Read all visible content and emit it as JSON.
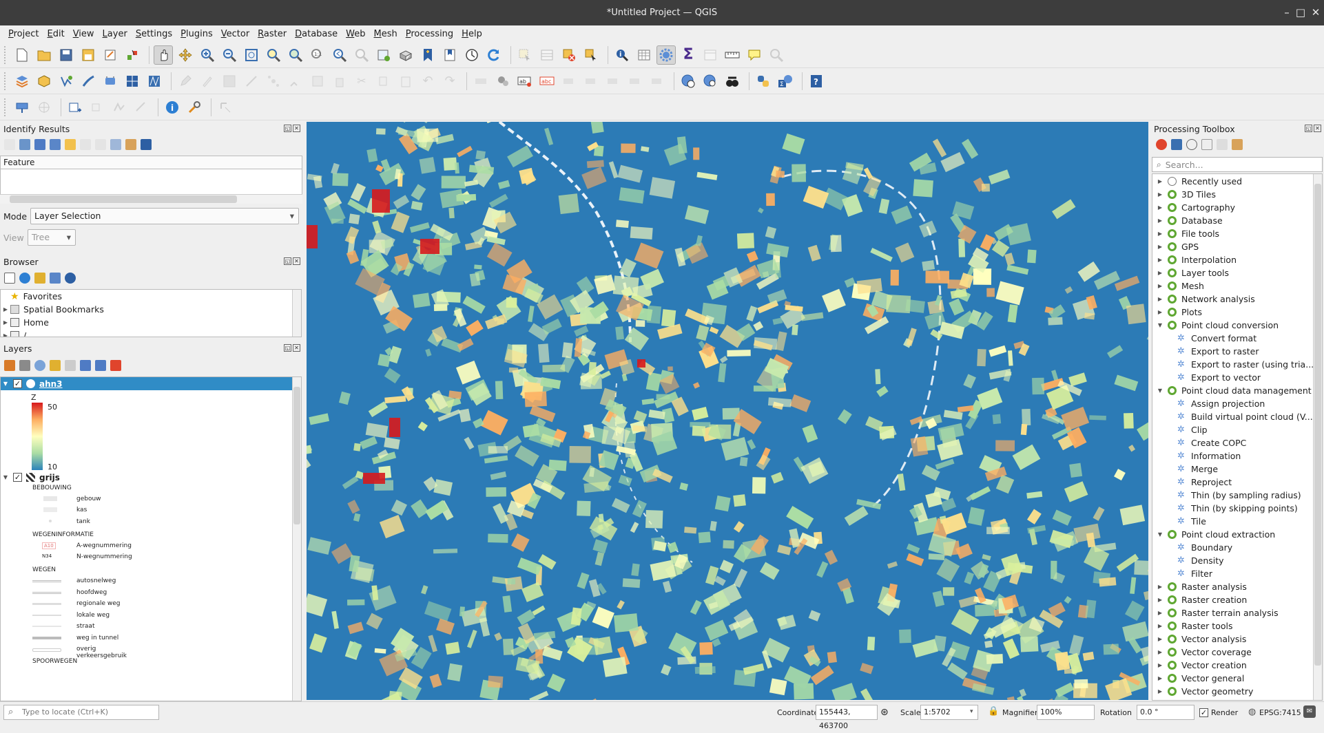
{
  "window": {
    "title": "*Untitled Project — QGIS",
    "minimize": "–",
    "maximize": "□",
    "close": "✕"
  },
  "menu": [
    "Project",
    "Edit",
    "View",
    "Layer",
    "Settings",
    "Plugins",
    "Vector",
    "Raster",
    "Database",
    "Web",
    "Mesh",
    "Processing",
    "Help"
  ],
  "identify": {
    "title": "Identify Results",
    "feature_header": "Feature",
    "mode_label": "Mode",
    "mode_value": "Layer Selection",
    "view_label": "View",
    "view_value": "Tree"
  },
  "browser": {
    "title": "Browser",
    "items": [
      {
        "label": "Favorites",
        "icon": "star-icon"
      },
      {
        "label": "Spatial Bookmarks",
        "icon": "bookmark-icon"
      },
      {
        "label": "Home",
        "icon": "home-icon"
      },
      {
        "label": "/",
        "icon": "folder-icon"
      }
    ]
  },
  "layers": {
    "title": "Layers",
    "ahn3": {
      "name": "ahn3",
      "band_label": "Z",
      "max": "50",
      "min": "10"
    },
    "grijs": {
      "name": "grijs",
      "groups": [
        {
          "title": "BEBOUWING",
          "items": [
            "gebouw",
            "kas",
            "tank"
          ]
        },
        {
          "title": "WEGENINFORMATIE",
          "items": [
            "A-wegnummering",
            "N-wegnummering"
          ],
          "badges": [
            "A10",
            "N34"
          ]
        },
        {
          "title": "WEGEN",
          "items": [
            "autosnelweg",
            "hoofdweg",
            "regionale weg",
            "lokale weg",
            "straat",
            "weg in tunnel",
            "overig verkeersgebruik"
          ]
        },
        {
          "title": "SPOORWEGEN",
          "items": []
        }
      ]
    }
  },
  "processing": {
    "title": "Processing Toolbox",
    "search_placeholder": "Search...",
    "tree": [
      {
        "label": "Recently used",
        "icon": "clock",
        "expanded": false
      },
      {
        "label": "3D Tiles",
        "icon": "qgis",
        "expanded": false
      },
      {
        "label": "Cartography",
        "icon": "qgis",
        "expanded": false
      },
      {
        "label": "Database",
        "icon": "qgis",
        "expanded": false
      },
      {
        "label": "File tools",
        "icon": "qgis",
        "expanded": false
      },
      {
        "label": "GPS",
        "icon": "qgis",
        "expanded": false
      },
      {
        "label": "Interpolation",
        "icon": "qgis",
        "expanded": false
      },
      {
        "label": "Layer tools",
        "icon": "qgis",
        "expanded": false
      },
      {
        "label": "Mesh",
        "icon": "qgis",
        "expanded": false
      },
      {
        "label": "Network analysis",
        "icon": "qgis",
        "expanded": false
      },
      {
        "label": "Plots",
        "icon": "qgis",
        "expanded": false
      },
      {
        "label": "Point cloud conversion",
        "icon": "qgis",
        "expanded": true
      },
      {
        "label": "Convert format",
        "icon": "gear",
        "child": true
      },
      {
        "label": "Export to raster",
        "icon": "gear",
        "child": true
      },
      {
        "label": "Export to raster (using tria...",
        "icon": "gear",
        "child": true
      },
      {
        "label": "Export to vector",
        "icon": "gear",
        "child": true
      },
      {
        "label": "Point cloud data management",
        "icon": "qgis",
        "expanded": true
      },
      {
        "label": "Assign projection",
        "icon": "gear",
        "child": true
      },
      {
        "label": "Build virtual point cloud (V...",
        "icon": "gear",
        "child": true
      },
      {
        "label": "Clip",
        "icon": "gear",
        "child": true
      },
      {
        "label": "Create COPC",
        "icon": "gear",
        "child": true
      },
      {
        "label": "Information",
        "icon": "gear",
        "child": true
      },
      {
        "label": "Merge",
        "icon": "gear",
        "child": true
      },
      {
        "label": "Reproject",
        "icon": "gear",
        "child": true
      },
      {
        "label": "Thin (by sampling radius)",
        "icon": "gear",
        "child": true
      },
      {
        "label": "Thin (by skipping points)",
        "icon": "gear",
        "child": true
      },
      {
        "label": "Tile",
        "icon": "gear",
        "child": true
      },
      {
        "label": "Point cloud extraction",
        "icon": "qgis",
        "expanded": true
      },
      {
        "label": "Boundary",
        "icon": "gear",
        "child": true
      },
      {
        "label": "Density",
        "icon": "gear",
        "child": true
      },
      {
        "label": "Filter",
        "icon": "gear",
        "child": true
      },
      {
        "label": "Raster analysis",
        "icon": "qgis",
        "expanded": false
      },
      {
        "label": "Raster creation",
        "icon": "qgis",
        "expanded": false
      },
      {
        "label": "Raster terrain analysis",
        "icon": "qgis",
        "expanded": false
      },
      {
        "label": "Raster tools",
        "icon": "qgis",
        "expanded": false
      },
      {
        "label": "Vector analysis",
        "icon": "qgis",
        "expanded": false
      },
      {
        "label": "Vector coverage",
        "icon": "qgis",
        "expanded": false
      },
      {
        "label": "Vector creation",
        "icon": "qgis",
        "expanded": false
      },
      {
        "label": "Vector general",
        "icon": "qgis",
        "expanded": false
      },
      {
        "label": "Vector geometry",
        "icon": "qgis",
        "expanded": false
      }
    ]
  },
  "status": {
    "locate_placeholder": "Type to locate (Ctrl+K)",
    "coordinate_label": "Coordinate",
    "coordinate_value": "155443, 463700",
    "scale_label": "Scale",
    "scale_value": "1:5702",
    "magnifier_label": "Magnifier",
    "magnifier_value": "100%",
    "rotation_label": "Rotation",
    "rotation_value": "0.0 °",
    "render_label": "Render",
    "crs": "EPSG:7415"
  },
  "colors": {
    "map_base": "#2c7bb6",
    "ramp_high": "#d7191c",
    "ramp_mid": "#ffffbf",
    "ramp_low": "#2c7bb6",
    "selection": "#308cc6"
  }
}
